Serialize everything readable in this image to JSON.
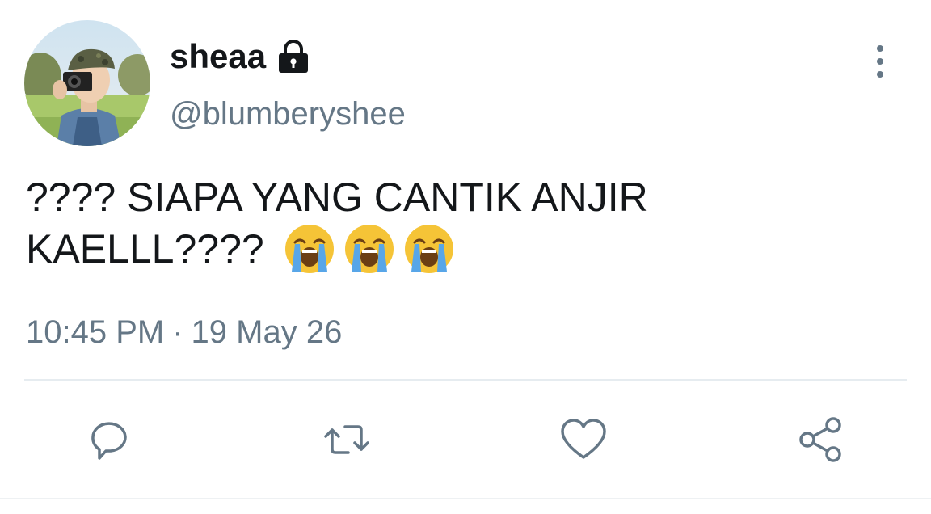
{
  "user": {
    "display_name": "sheaa",
    "handle": "@blumberyshee",
    "protected": true
  },
  "tweet": {
    "line1": "???? SIAPA YANG CANTIK ANJIR",
    "line2": "KAELLL????",
    "emojis": [
      "loudly-crying-face",
      "loudly-crying-face",
      "loudly-crying-face"
    ]
  },
  "meta": {
    "time": "10:45 PM",
    "separator": "·",
    "date": "19 May 26"
  },
  "actions": {
    "reply": "reply-icon",
    "retweet": "retweet-icon",
    "like": "heart-icon",
    "share": "share-icon"
  },
  "colors": {
    "text": "#14171a",
    "muted": "#657786",
    "icon": "#657786",
    "divider": "#e6ecf0"
  }
}
